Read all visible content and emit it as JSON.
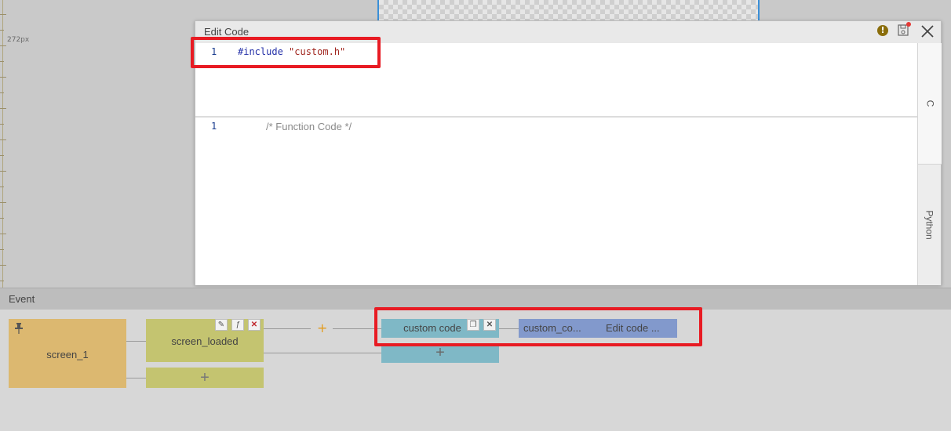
{
  "canvas": {
    "ruler_label": "272px"
  },
  "dialog": {
    "title": "Edit Code",
    "warn_icon": "!",
    "header_code": {
      "line_number": "1",
      "keyword": "#include",
      "string": "\"custom.h\""
    },
    "function_code": {
      "line_number": "1",
      "comment": "/* Function Code */"
    },
    "lang_tabs": [
      "C",
      "Python"
    ]
  },
  "event_panel": {
    "title": "Event",
    "screen_node": {
      "label": "screen_1",
      "icon": "pin-icon"
    },
    "trigger_node": {
      "label": "screen_loaded",
      "buttons": [
        "edit-icon",
        "code-icon",
        "delete-icon"
      ]
    },
    "trigger_add": "+",
    "branch_add": "+",
    "custom_node": {
      "label": "custom code",
      "buttons": [
        "copy-icon",
        "close-icon"
      ]
    },
    "custom_add": "+",
    "action_node": {
      "name": "custom_co...",
      "value": "Edit code ..."
    }
  },
  "colors": {
    "screen_node": "#dcb870",
    "trigger_node": "#c4c470",
    "custom_node": "#7fb8c6",
    "action_node": "#8299cc",
    "highlight": "#e81b23",
    "plus_orange": "#e39b1c"
  }
}
